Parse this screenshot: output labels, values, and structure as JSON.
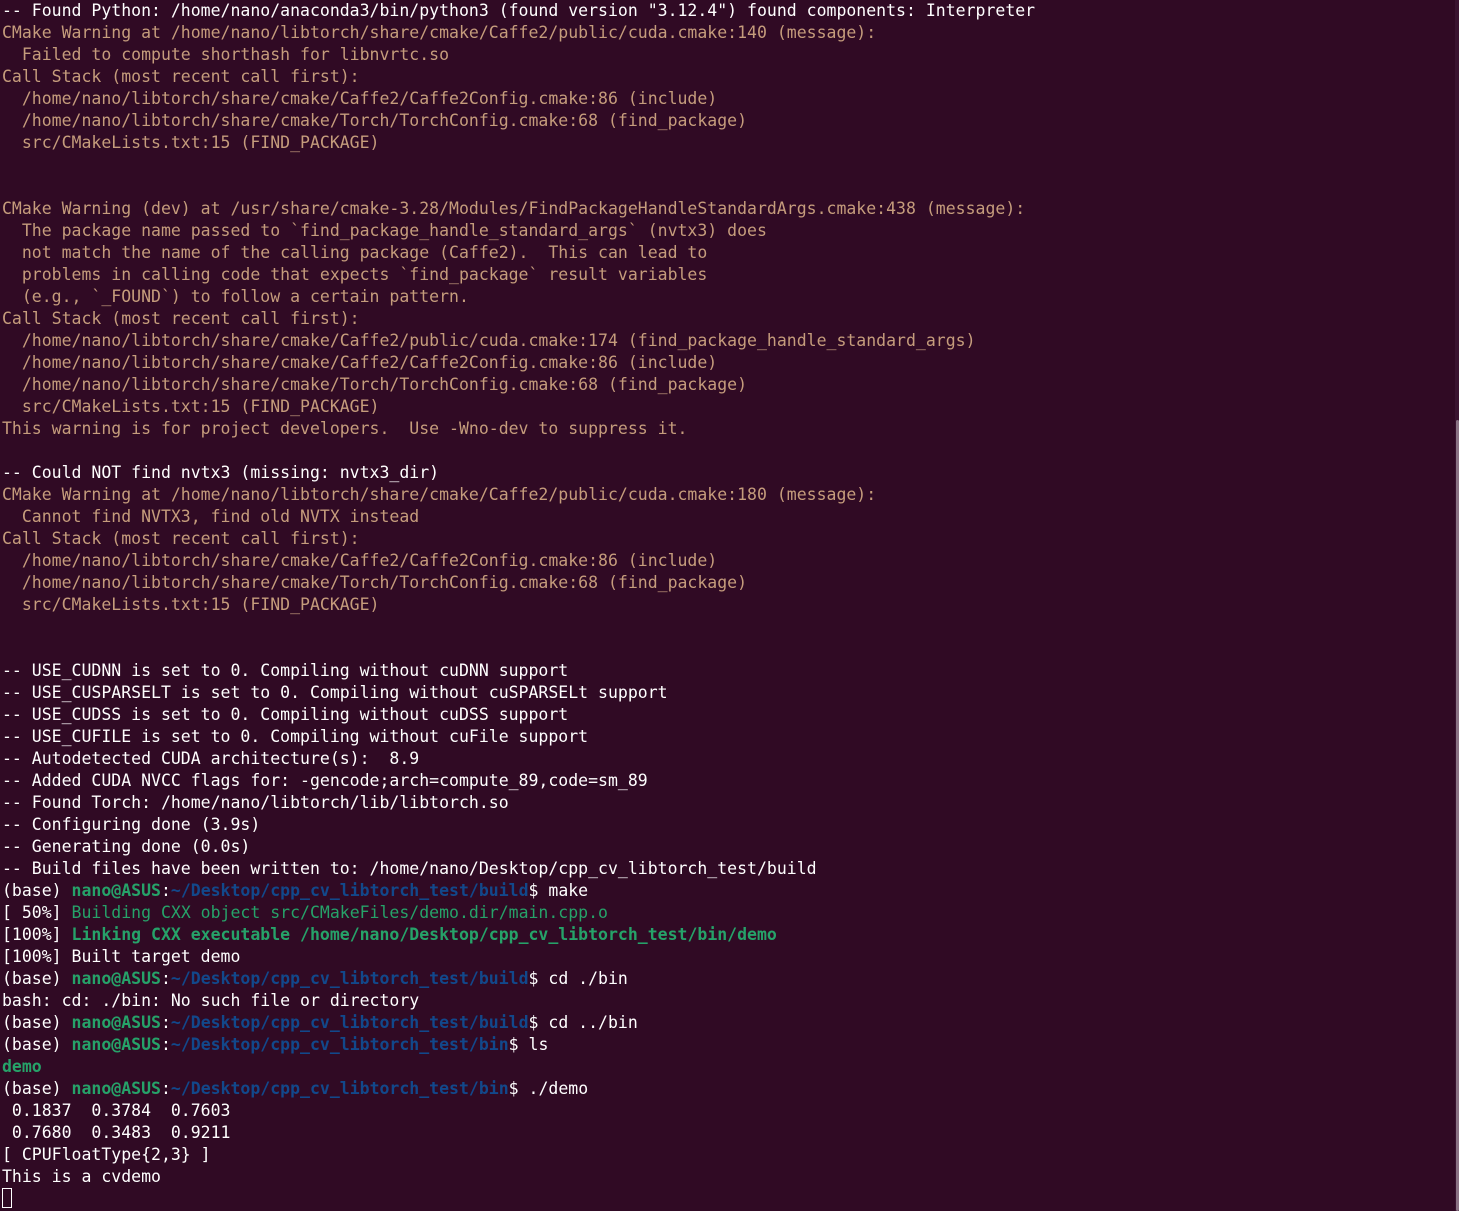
{
  "colors": {
    "background": "#300a24",
    "text": "#ffffff",
    "warning": "#c59c7c",
    "user_host": "#26a269",
    "path": "#12488b",
    "make_progress": "#26a269",
    "executable": "#26a269",
    "scrollbar_track": "#3a1430",
    "scrollbar_thumb": "#8a7384"
  },
  "terminal": {
    "lines": [
      {
        "segments": [
          {
            "text": "-- Found Python: /home/nano/anaconda3/bin/python3 (found version \"3.12.4\") found components: Interpreter",
            "style": "normal"
          }
        ]
      },
      {
        "segments": [
          {
            "text": "CMake Warning at /home/nano/libtorch/share/cmake/Caffe2/public/cuda.cmake:140 (message):",
            "style": "warn"
          }
        ]
      },
      {
        "segments": [
          {
            "text": "  Failed to compute shorthash for libnvrtc.so",
            "style": "warn"
          }
        ]
      },
      {
        "segments": [
          {
            "text": "Call Stack (most recent call first):",
            "style": "warn"
          }
        ]
      },
      {
        "segments": [
          {
            "text": "  /home/nano/libtorch/share/cmake/Caffe2/Caffe2Config.cmake:86 (include)",
            "style": "warn"
          }
        ]
      },
      {
        "segments": [
          {
            "text": "  /home/nano/libtorch/share/cmake/Torch/TorchConfig.cmake:68 (find_package)",
            "style": "warn"
          }
        ]
      },
      {
        "segments": [
          {
            "text": "  src/CMakeLists.txt:15 (FIND_PACKAGE)",
            "style": "warn"
          }
        ]
      },
      {
        "segments": [
          {
            "text": "",
            "style": "normal"
          }
        ]
      },
      {
        "segments": [
          {
            "text": "",
            "style": "normal"
          }
        ]
      },
      {
        "segments": [
          {
            "text": "CMake Warning (dev) at /usr/share/cmake-3.28/Modules/FindPackageHandleStandardArgs.cmake:438 (message):",
            "style": "warn"
          }
        ]
      },
      {
        "segments": [
          {
            "text": "  The package name passed to `find_package_handle_standard_args` (nvtx3) does",
            "style": "warn"
          }
        ]
      },
      {
        "segments": [
          {
            "text": "  not match the name of the calling package (Caffe2).  This can lead to",
            "style": "warn"
          }
        ]
      },
      {
        "segments": [
          {
            "text": "  problems in calling code that expects `find_package` result variables",
            "style": "warn"
          }
        ]
      },
      {
        "segments": [
          {
            "text": "  (e.g., `_FOUND`) to follow a certain pattern.",
            "style": "warn"
          }
        ]
      },
      {
        "segments": [
          {
            "text": "Call Stack (most recent call first):",
            "style": "warn"
          }
        ]
      },
      {
        "segments": [
          {
            "text": "  /home/nano/libtorch/share/cmake/Caffe2/public/cuda.cmake:174 (find_package_handle_standard_args)",
            "style": "warn"
          }
        ]
      },
      {
        "segments": [
          {
            "text": "  /home/nano/libtorch/share/cmake/Caffe2/Caffe2Config.cmake:86 (include)",
            "style": "warn"
          }
        ]
      },
      {
        "segments": [
          {
            "text": "  /home/nano/libtorch/share/cmake/Torch/TorchConfig.cmake:68 (find_package)",
            "style": "warn"
          }
        ]
      },
      {
        "segments": [
          {
            "text": "  src/CMakeLists.txt:15 (FIND_PACKAGE)",
            "style": "warn"
          }
        ]
      },
      {
        "segments": [
          {
            "text": "This warning is for project developers.  Use -Wno-dev to suppress it.",
            "style": "warn"
          }
        ]
      },
      {
        "segments": [
          {
            "text": "",
            "style": "normal"
          }
        ]
      },
      {
        "segments": [
          {
            "text": "-- Could NOT find nvtx3 (missing: nvtx3_dir)",
            "style": "normal"
          }
        ]
      },
      {
        "segments": [
          {
            "text": "CMake Warning at /home/nano/libtorch/share/cmake/Caffe2/public/cuda.cmake:180 (message):",
            "style": "warn"
          }
        ]
      },
      {
        "segments": [
          {
            "text": "  Cannot find NVTX3, find old NVTX instead",
            "style": "warn"
          }
        ]
      },
      {
        "segments": [
          {
            "text": "Call Stack (most recent call first):",
            "style": "warn"
          }
        ]
      },
      {
        "segments": [
          {
            "text": "  /home/nano/libtorch/share/cmake/Caffe2/Caffe2Config.cmake:86 (include)",
            "style": "warn"
          }
        ]
      },
      {
        "segments": [
          {
            "text": "  /home/nano/libtorch/share/cmake/Torch/TorchConfig.cmake:68 (find_package)",
            "style": "warn"
          }
        ]
      },
      {
        "segments": [
          {
            "text": "  src/CMakeLists.txt:15 (FIND_PACKAGE)",
            "style": "warn"
          }
        ]
      },
      {
        "segments": [
          {
            "text": "",
            "style": "normal"
          }
        ]
      },
      {
        "segments": [
          {
            "text": "",
            "style": "normal"
          }
        ]
      },
      {
        "segments": [
          {
            "text": "-- USE_CUDNN is set to 0. Compiling without cuDNN support",
            "style": "normal"
          }
        ]
      },
      {
        "segments": [
          {
            "text": "-- USE_CUSPARSELT is set to 0. Compiling without cuSPARSELt support",
            "style": "normal"
          }
        ]
      },
      {
        "segments": [
          {
            "text": "-- USE_CUDSS is set to 0. Compiling without cuDSS support",
            "style": "normal"
          }
        ]
      },
      {
        "segments": [
          {
            "text": "-- USE_CUFILE is set to 0. Compiling without cuFile support",
            "style": "normal"
          }
        ]
      },
      {
        "segments": [
          {
            "text": "-- Autodetected CUDA architecture(s):  8.9",
            "style": "normal"
          }
        ]
      },
      {
        "segments": [
          {
            "text": "-- Added CUDA NVCC flags for: -gencode;arch=compute_89,code=sm_89",
            "style": "normal"
          }
        ]
      },
      {
        "segments": [
          {
            "text": "-- Found Torch: /home/nano/libtorch/lib/libtorch.so",
            "style": "normal"
          }
        ]
      },
      {
        "segments": [
          {
            "text": "-- Configuring done (3.9s)",
            "style": "normal"
          }
        ]
      },
      {
        "segments": [
          {
            "text": "-- Generating done (0.0s)",
            "style": "normal"
          }
        ]
      },
      {
        "segments": [
          {
            "text": "-- Build files have been written to: /home/nano/Desktop/cpp_cv_libtorch_test/build",
            "style": "normal"
          }
        ]
      },
      {
        "segments": [
          {
            "text": "(base) ",
            "style": "normal"
          },
          {
            "text": "nano@ASUS",
            "style": "user"
          },
          {
            "text": ":",
            "style": "normal"
          },
          {
            "text": "~/Desktop/cpp_cv_libtorch_test/build",
            "style": "path"
          },
          {
            "text": "$ make",
            "style": "normal"
          }
        ]
      },
      {
        "segments": [
          {
            "text": "[ 50%] ",
            "style": "normal"
          },
          {
            "text": "Building CXX object src/CMakeFiles/demo.dir/main.cpp.o",
            "style": "green"
          }
        ]
      },
      {
        "segments": [
          {
            "text": "[100%] ",
            "style": "normal"
          },
          {
            "text": "Linking CXX executable /home/nano/Desktop/cpp_cv_libtorch_test/bin/demo",
            "style": "greenbold"
          }
        ]
      },
      {
        "segments": [
          {
            "text": "[100%] Built target demo",
            "style": "normal"
          }
        ]
      },
      {
        "segments": [
          {
            "text": "(base) ",
            "style": "normal"
          },
          {
            "text": "nano@ASUS",
            "style": "user"
          },
          {
            "text": ":",
            "style": "normal"
          },
          {
            "text": "~/Desktop/cpp_cv_libtorch_test/build",
            "style": "path"
          },
          {
            "text": "$ cd ./bin",
            "style": "normal"
          }
        ]
      },
      {
        "segments": [
          {
            "text": "bash: cd: ./bin: No such file or directory",
            "style": "normal"
          }
        ]
      },
      {
        "segments": [
          {
            "text": "(base) ",
            "style": "normal"
          },
          {
            "text": "nano@ASUS",
            "style": "user"
          },
          {
            "text": ":",
            "style": "normal"
          },
          {
            "text": "~/Desktop/cpp_cv_libtorch_test/build",
            "style": "path"
          },
          {
            "text": "$ cd ../bin",
            "style": "normal"
          }
        ]
      },
      {
        "segments": [
          {
            "text": "(base) ",
            "style": "normal"
          },
          {
            "text": "nano@ASUS",
            "style": "user"
          },
          {
            "text": ":",
            "style": "normal"
          },
          {
            "text": "~/Desktop/cpp_cv_libtorch_test/bin",
            "style": "path"
          },
          {
            "text": "$ ls",
            "style": "normal"
          }
        ]
      },
      {
        "segments": [
          {
            "text": "demo",
            "style": "exec"
          }
        ]
      },
      {
        "segments": [
          {
            "text": "(base) ",
            "style": "normal"
          },
          {
            "text": "nano@ASUS",
            "style": "user"
          },
          {
            "text": ":",
            "style": "normal"
          },
          {
            "text": "~/Desktop/cpp_cv_libtorch_test/bin",
            "style": "path"
          },
          {
            "text": "$ ./demo",
            "style": "normal"
          }
        ]
      },
      {
        "segments": [
          {
            "text": " 0.1837  0.3784  0.7603",
            "style": "normal"
          }
        ]
      },
      {
        "segments": [
          {
            "text": " 0.7680  0.3483  0.9211",
            "style": "normal"
          }
        ]
      },
      {
        "segments": [
          {
            "text": "[ CPUFloatType{2,3} ]",
            "style": "normal"
          }
        ]
      },
      {
        "segments": [
          {
            "text": "This is a cvdemo",
            "style": "normal"
          }
        ]
      }
    ]
  }
}
